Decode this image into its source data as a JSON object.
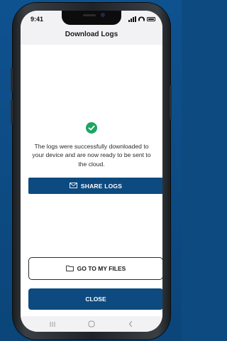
{
  "status_bar": {
    "time": "9:41"
  },
  "header": {
    "title": "Download Logs"
  },
  "message": "The logs were successfully downloaded to your device and are now ready to be sent to the cloud.",
  "buttons": {
    "share": "SHARE LOGS",
    "go_to_files": "GO TO MY FILES",
    "close": "CLOSE"
  },
  "icons": {
    "success": "check-circle-icon",
    "share": "mail-icon",
    "files": "folder-icon"
  },
  "colors": {
    "primary": "#0d4a80",
    "success": "#1fa463",
    "background": "#0f5290"
  }
}
